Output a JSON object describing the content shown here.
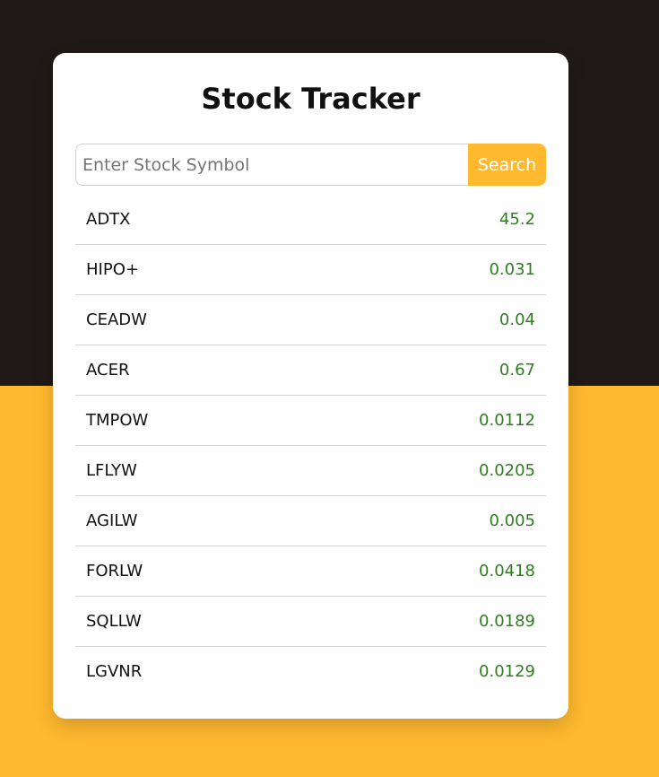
{
  "app": {
    "title": "Stock Tracker"
  },
  "search": {
    "placeholder": "Enter Stock Symbol",
    "value": "",
    "button_label": "Search"
  },
  "stocks": [
    {
      "symbol": "ADTX",
      "price": "45.2"
    },
    {
      "symbol": "HIPO+",
      "price": "0.031"
    },
    {
      "symbol": "CEADW",
      "price": "0.04"
    },
    {
      "symbol": "ACER",
      "price": "0.67"
    },
    {
      "symbol": "TMPOW",
      "price": "0.0112"
    },
    {
      "symbol": "LFLYW",
      "price": "0.0205"
    },
    {
      "symbol": "AGILW",
      "price": "0.005"
    },
    {
      "symbol": "FORLW",
      "price": "0.0418"
    },
    {
      "symbol": "SQLLW",
      "price": "0.0189"
    },
    {
      "symbol": "LGVNR",
      "price": "0.0129"
    }
  ],
  "colors": {
    "background_dark": "#1f1a17",
    "accent": "#ffb92e",
    "price_green": "#2f7d22",
    "card_bg": "#ffffff"
  }
}
